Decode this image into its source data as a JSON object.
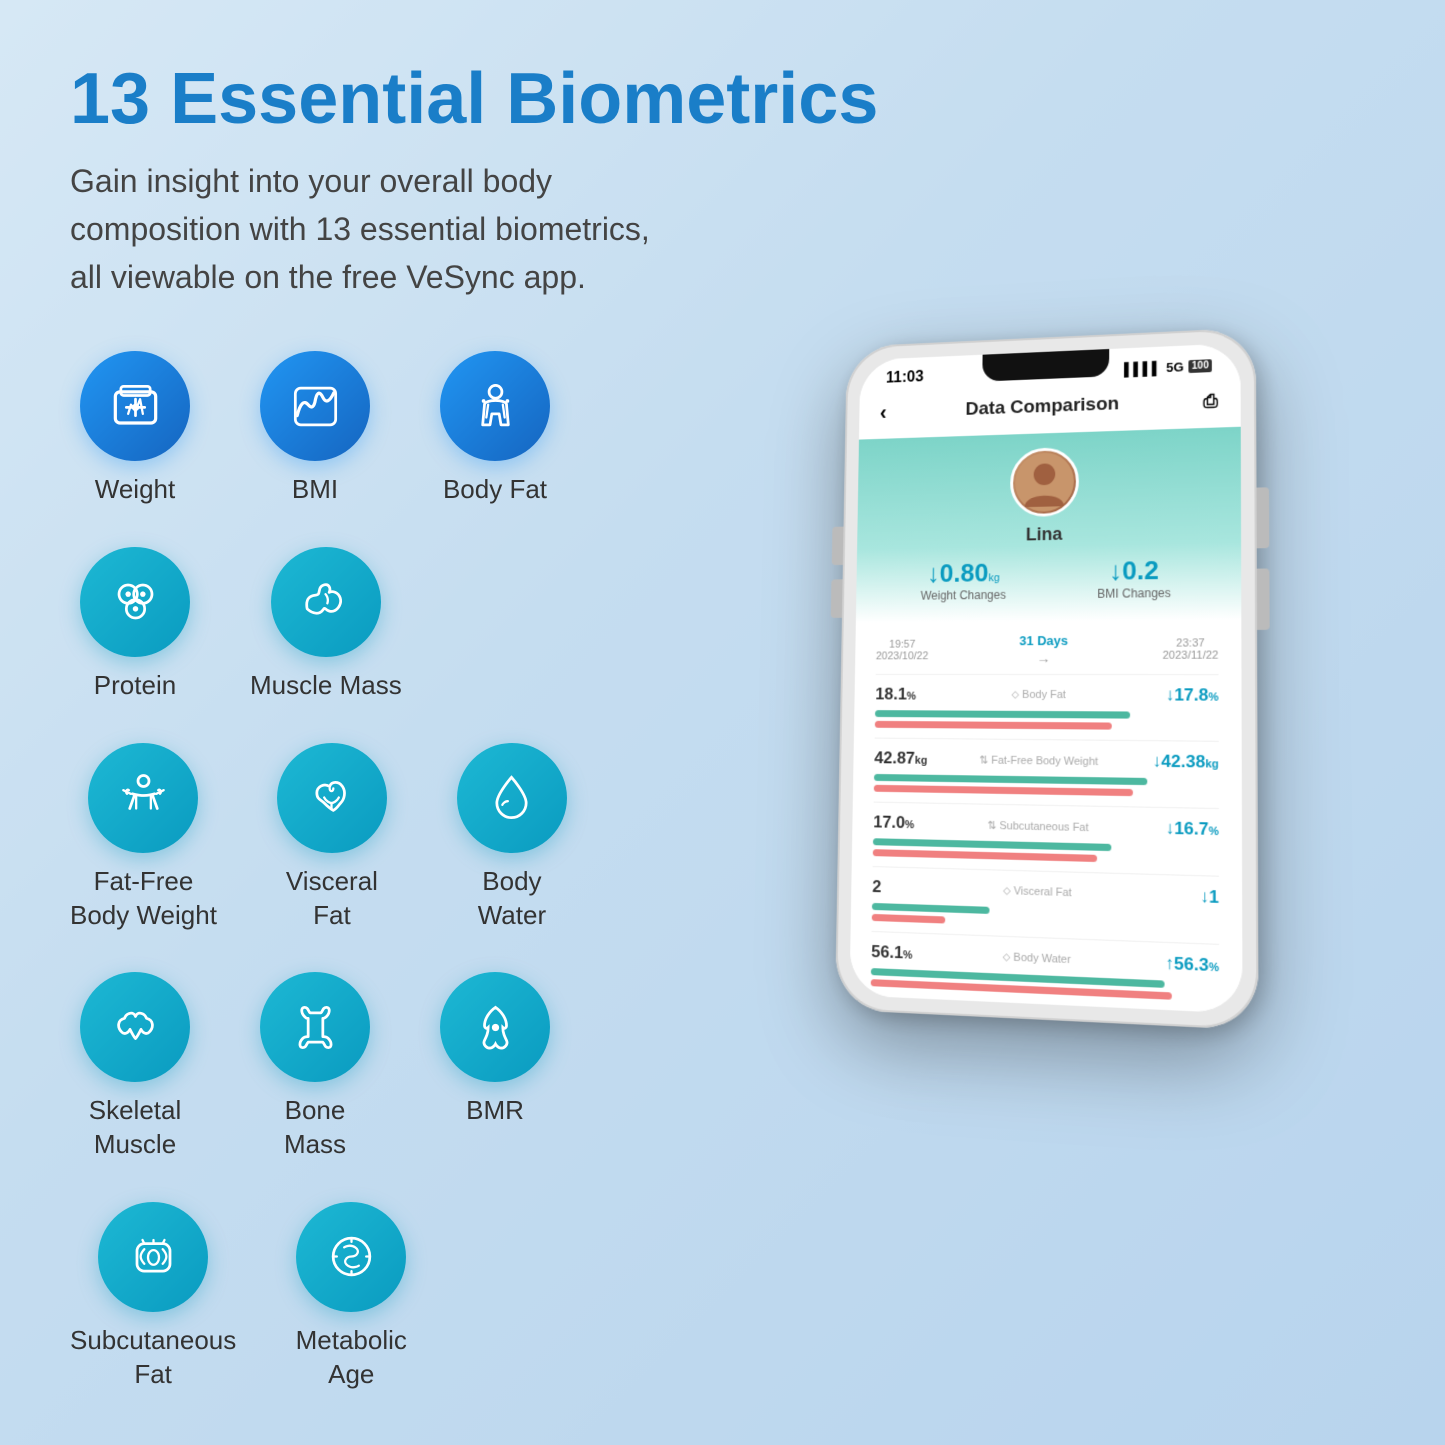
{
  "page": {
    "title": "13 Essential Biometrics",
    "subtitle": "Gain insight into your overall body composition with 13 essential biometrics, all viewable on the free VeSync app.",
    "accent_color": "#1a7ec8",
    "icon_color": "#0a9bc0",
    "icon_color_blue": "#1976d2"
  },
  "biometrics": {
    "row1": [
      {
        "label": "Weight",
        "icon": "weight"
      },
      {
        "label": "BMI",
        "icon": "bmi"
      },
      {
        "label": "Body Fat",
        "icon": "bodyfat"
      }
    ],
    "row2": [
      {
        "label": "Protein",
        "icon": "protein"
      },
      {
        "label": "Muscle Mass",
        "icon": "musclemass"
      }
    ],
    "row3": [
      {
        "label": "Fat-Free\nBody Weight",
        "icon": "fatfree"
      },
      {
        "label": "Visceral\nFat",
        "icon": "visceralfat"
      },
      {
        "label": "Body\nWater",
        "icon": "bodywater"
      }
    ],
    "row4": [
      {
        "label": "Skeletal\nMuscle",
        "icon": "skeletal"
      },
      {
        "label": "Bone\nMass",
        "icon": "bonemass"
      },
      {
        "label": "BMR",
        "icon": "bmr"
      }
    ],
    "row5": [
      {
        "label": "Subcutaneous\nFat",
        "icon": "subcutaneous"
      },
      {
        "label": "Metabolic\nAge",
        "icon": "metabolic"
      }
    ]
  },
  "phone": {
    "status_time": "11:03",
    "status_signal": "5G",
    "status_battery": "100",
    "app_title": "Data Comparison",
    "profile_name": "Lina",
    "weight_change_label": "Weight Changes",
    "weight_change_value": "↓0.80",
    "weight_unit": "kg",
    "bmi_change_label": "BMI Changes",
    "bmi_change_value": "↓0.2",
    "date_left": "19:57\n2023/10/22",
    "date_middle": "31 Days",
    "date_right": "23:37\n2023/11/22",
    "data_rows": [
      {
        "left": "18.1%",
        "label": "Body Fat",
        "right": "↓17.8%",
        "bar1_width": "75%",
        "bar2_width": "72%"
      },
      {
        "left": "42.87kg",
        "label": "Fat-Free Body Weight",
        "right": "↓42.38kg",
        "bar1_width": "80%",
        "bar2_width": "78%"
      },
      {
        "left": "17.0%",
        "label": "Subcutaneous Fat",
        "right": "↓16.7%",
        "bar1_width": "70%",
        "bar2_width": "68%"
      },
      {
        "left": "2",
        "label": "Visceral Fat",
        "right": "↓1",
        "bar1_width": "35%",
        "bar2_width": "25%"
      },
      {
        "left": "56.1%",
        "label": "Body Water",
        "right": "↑56.3%",
        "bar1_width": "85%",
        "bar2_width": "87%"
      }
    ]
  }
}
